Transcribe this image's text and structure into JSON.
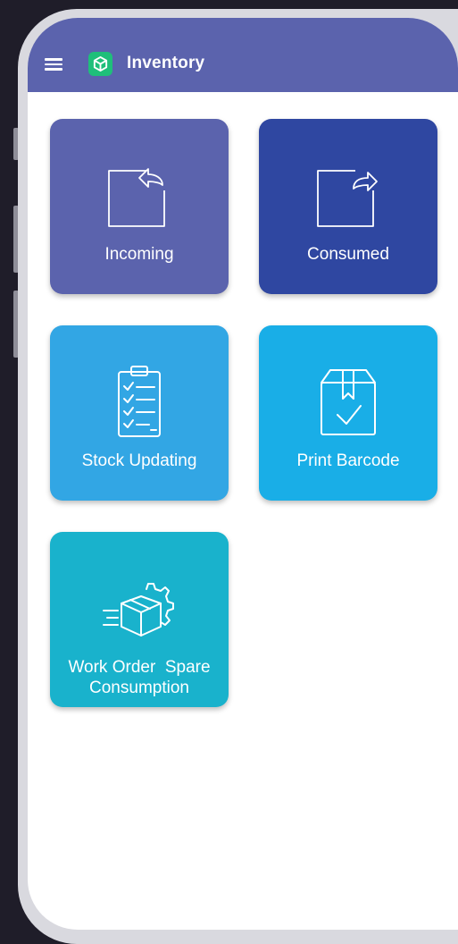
{
  "app": {
    "title": "Inventory",
    "menu_icon": "hamburger-menu-icon",
    "logo_icon": "box-logo-icon",
    "header_color": "#5b63ad",
    "logo_color": "#1fbf7a"
  },
  "tiles": [
    {
      "label": "Incoming",
      "icon": "incoming-arrow-icon",
      "color": "#5b63ad"
    },
    {
      "label": "Consumed",
      "icon": "outgoing-arrow-icon",
      "color": "#2f47a1"
    },
    {
      "label": "Stock Updating",
      "icon": "checklist-clipboard-icon",
      "color": "#32a6e4"
    },
    {
      "label": "Print Barcode",
      "icon": "package-check-icon",
      "color": "#19aee7"
    },
    {
      "label": "Work Order  Spare Consumption",
      "icon": "gear-box-icon",
      "color": "#19b2cc"
    }
  ]
}
